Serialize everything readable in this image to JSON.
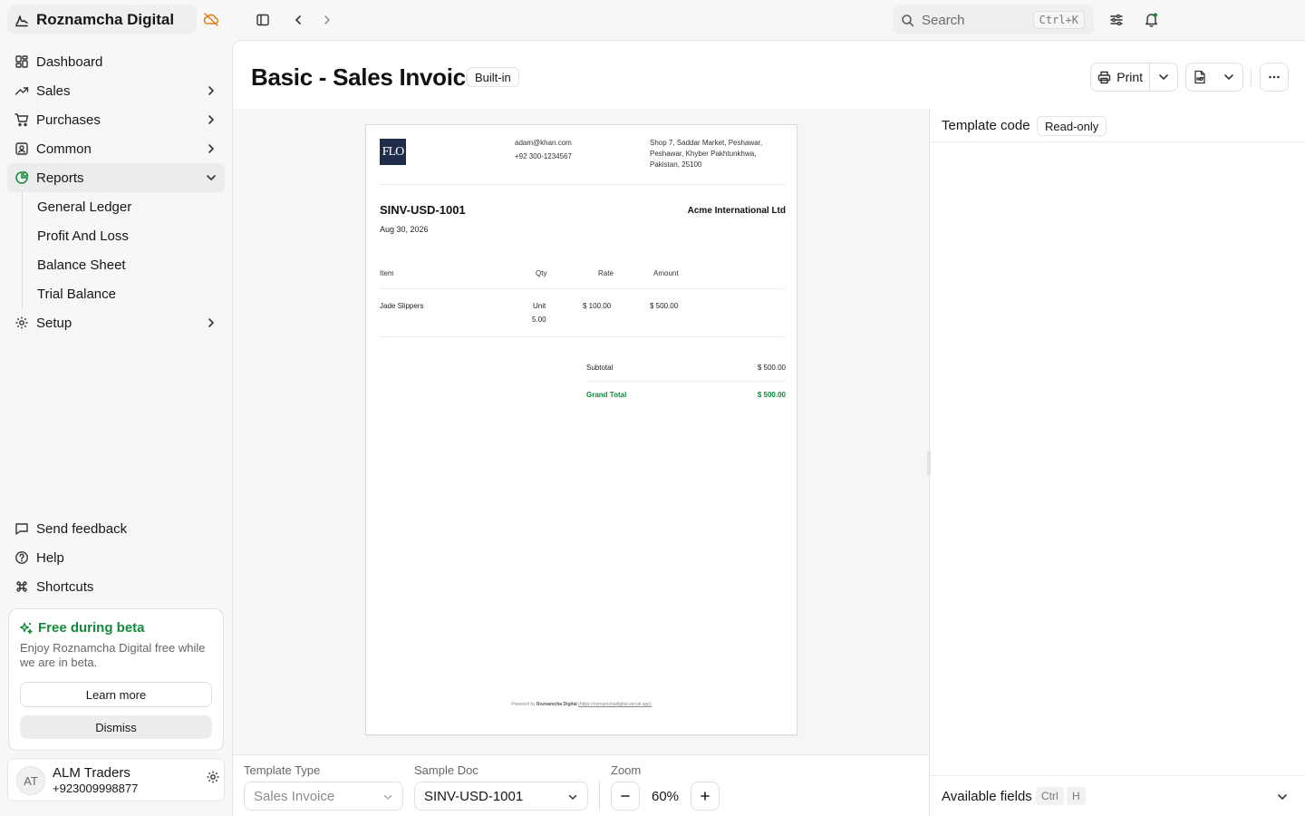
{
  "app": {
    "name": "Roznamcha Digital"
  },
  "sidebar": {
    "items": [
      {
        "label": "Dashboard"
      },
      {
        "label": "Sales"
      },
      {
        "label": "Purchases"
      },
      {
        "label": "Common"
      },
      {
        "label": "Reports"
      },
      {
        "label": "Setup"
      }
    ],
    "reports_sub": [
      {
        "label": "General Ledger"
      },
      {
        "label": "Profit And Loss"
      },
      {
        "label": "Balance Sheet"
      },
      {
        "label": "Trial Balance"
      }
    ],
    "bottom": [
      {
        "label": "Send feedback"
      },
      {
        "label": "Help"
      },
      {
        "label": "Shortcuts"
      }
    ],
    "beta": {
      "title": "Free during beta",
      "text": "Enjoy Roznamcha Digital free while we are in beta.",
      "learn_more": "Learn more",
      "dismiss": "Dismiss"
    },
    "account": {
      "initials": "AT",
      "name": "ALM Traders",
      "phone": "+923009998877"
    }
  },
  "topbar": {
    "search_placeholder": "Search",
    "search_shortcut": "Ctrl+K"
  },
  "page": {
    "title": "Basic - Sales Invoice",
    "badge": "Built-in",
    "print_label": "Print"
  },
  "invoice": {
    "logo_text": "FLO",
    "email": "adam@khan.com",
    "phone": "+92 300-1234567",
    "address_line1": "Shop 7, Saddar Market, Peshawar,",
    "address_line2": "Peshawar, Khyber Pakhtunkhwa,",
    "address_line3": "Pakistan, 25100",
    "number": "SINV-USD-1001",
    "date": "Aug 30, 2026",
    "customer": "Acme International Ltd",
    "columns": {
      "item": "Item",
      "qty": "Qty",
      "rate": "Rate",
      "amount": "Amount"
    },
    "rows": [
      {
        "item": "Jade Slippers",
        "unit": "Unit",
        "qty": "5.00",
        "rate": "$ 100.00",
        "amount": "$ 500.00"
      }
    ],
    "subtotal_label": "Subtotal",
    "subtotal": "$ 500.00",
    "grand_total_label": "Grand Total",
    "grand_total": "$ 500.00",
    "powered_by_prefix": "Powered by",
    "powered_by_name": "Roznamcha Digital",
    "powered_by_url": "(https://roznamchadigital.vercel.app)"
  },
  "controls": {
    "template_type_label": "Template Type",
    "template_type_value": "Sales Invoice",
    "sample_doc_label": "Sample Doc",
    "sample_doc_value": "SINV-USD-1001",
    "zoom_label": "Zoom",
    "zoom_value": "60%"
  },
  "code_panel": {
    "title": "Template code",
    "badge": "Read-only",
    "fields_title": "Available fields",
    "fields_key1": "Ctrl",
    "fields_key2": "H"
  },
  "colors": {
    "accent_green": "#138a3a",
    "beta_icon": "#138a3a",
    "brand_side_icon": "#e07b12"
  }
}
